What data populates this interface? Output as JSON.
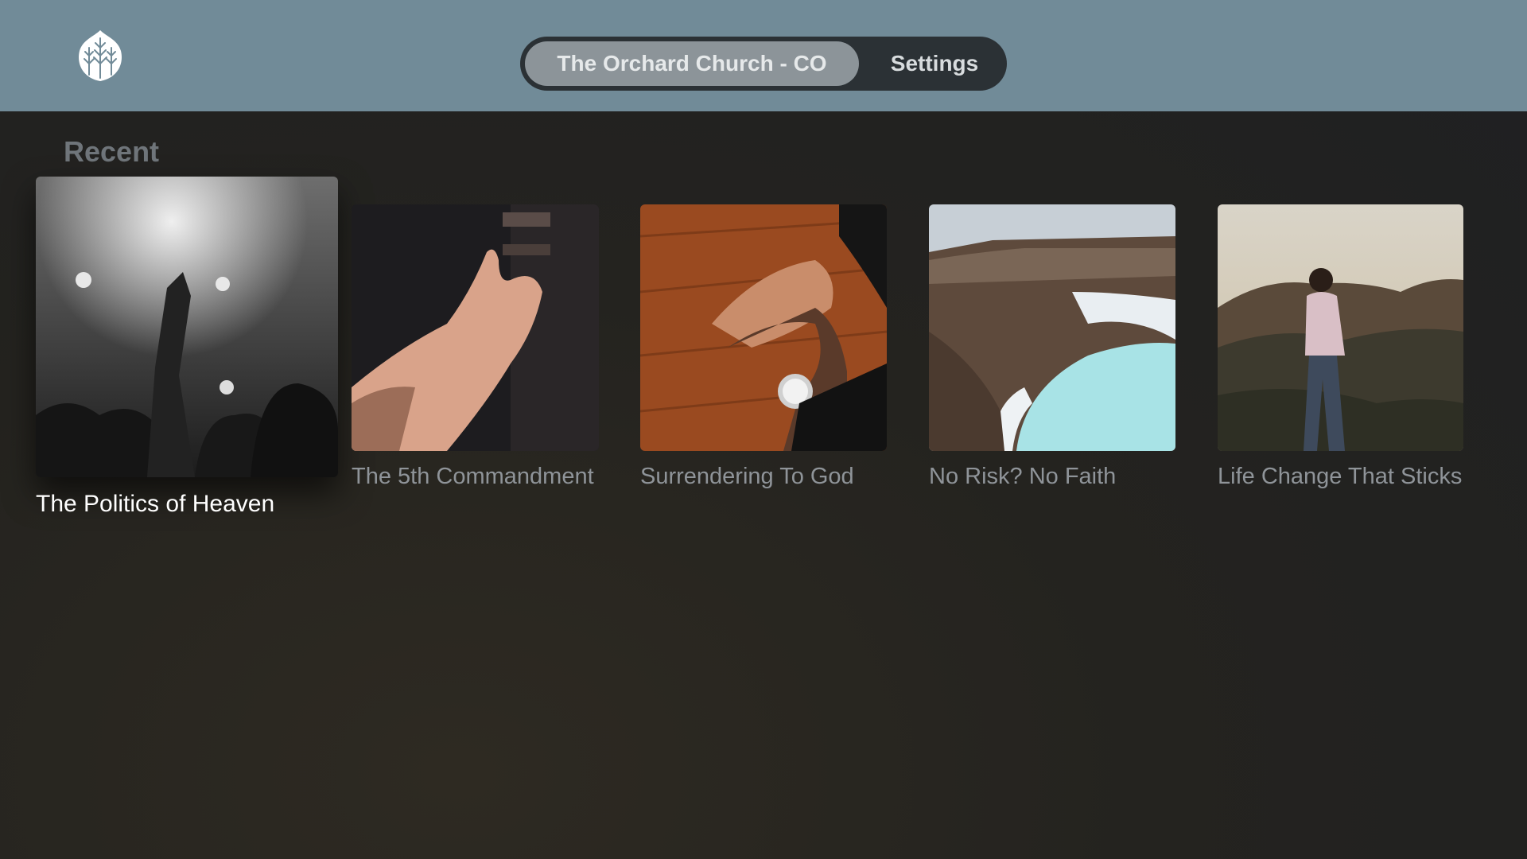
{
  "header": {
    "logo_icon": "orchard-tree-leaf-icon",
    "tabs": [
      {
        "label": "The Orchard Church - CO",
        "selected": true
      },
      {
        "label": "Settings",
        "selected": false
      }
    ]
  },
  "recent": {
    "title": "Recent",
    "items": [
      {
        "title": "The Politics of Heaven",
        "focused": true
      },
      {
        "title": "The 5th Commandment",
        "focused": false
      },
      {
        "title": "Surrendering To God",
        "focused": false
      },
      {
        "title": "No Risk? No Faith",
        "focused": false
      },
      {
        "title": "Life Change That Sticks",
        "focused": false
      }
    ]
  },
  "colors": {
    "header_bg": "#718b98",
    "segment_bg": "#2b3135",
    "segment_active": "#8c9499",
    "page_bg": "#24231f"
  }
}
